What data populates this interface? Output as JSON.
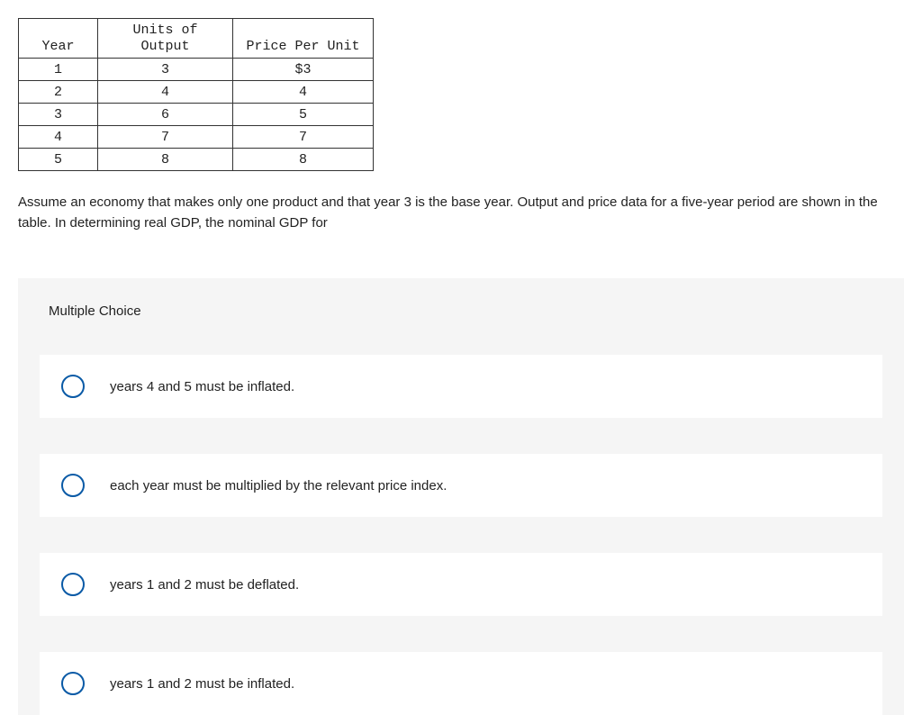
{
  "table": {
    "headers": {
      "year": "Year",
      "units": "Units of\nOutput",
      "price": "Price Per Unit"
    },
    "rows": [
      {
        "year": "1",
        "units": "3",
        "price": "$3"
      },
      {
        "year": "2",
        "units": "4",
        "price": "4"
      },
      {
        "year": "3",
        "units": "6",
        "price": "5"
      },
      {
        "year": "4",
        "units": "7",
        "price": "7"
      },
      {
        "year": "5",
        "units": "8",
        "price": "8"
      }
    ]
  },
  "question": "Assume an economy that makes only one product and that year 3 is the base year. Output and price data for a five-year period are shown in the table. In determining real GDP, the nominal GDP for",
  "section_label": "Multiple Choice",
  "choices": [
    {
      "text": "years 4 and 5 must be inflated."
    },
    {
      "text": "each year must be multiplied by the relevant price index."
    },
    {
      "text": "years 1 and 2 must be deflated."
    },
    {
      "text": "years 1 and 2 must be inflated."
    }
  ]
}
